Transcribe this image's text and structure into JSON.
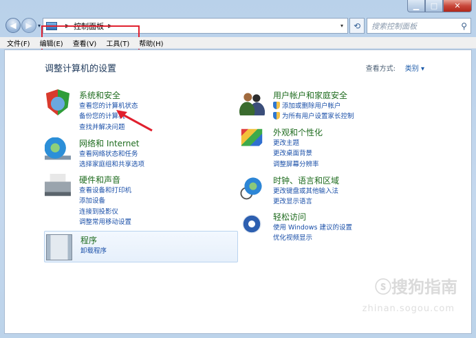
{
  "window": {
    "caption": {
      "minimize": "▁",
      "maximize": "□",
      "close": "✕"
    }
  },
  "nav": {
    "back": "◀",
    "forward": "▶",
    "dropdown": "▾",
    "breadcrumb": [
      "控制面板"
    ],
    "crumb_sep": "▶",
    "refresh": "⟲",
    "search_placeholder": "搜索控制面板",
    "search_icon": "⚲"
  },
  "menubar": [
    "文件(F)",
    "编辑(E)",
    "查看(V)",
    "工具(T)",
    "帮助(H)"
  ],
  "header": {
    "title": "调整计算机的设置",
    "view_by_label": "查看方式:",
    "view_by_value": "类别 ▾"
  },
  "categories_left": [
    {
      "title": "系统和安全",
      "icon": "shield-icon",
      "links": [
        "查看您的计算机状态",
        "备份您的计算机",
        "查找并解决问题"
      ]
    },
    {
      "title": "网络和 Internet",
      "icon": "network-globe-icon",
      "links": [
        "查看网络状态和任务",
        "选择家庭组和共享选项"
      ]
    },
    {
      "title": "硬件和声音",
      "icon": "printer-icon",
      "links": [
        "查看设备和打印机",
        "添加设备",
        "连接到投影仪",
        "调整常用移动设置"
      ]
    },
    {
      "title": "程序",
      "icon": "programs-icon",
      "links": [
        "卸载程序"
      ]
    }
  ],
  "categories_right": [
    {
      "title": "用户帐户和家庭安全",
      "icon": "users-icon",
      "links": [
        "添加或删除用户帐户",
        "为所有用户设置家长控制"
      ],
      "shield_links": [
        true,
        true
      ]
    },
    {
      "title": "外观和个性化",
      "icon": "display-icon",
      "links": [
        "更改主题",
        "更改桌面背景",
        "调整屏幕分辨率"
      ]
    },
    {
      "title": "时钟、语言和区域",
      "icon": "clock-globe-icon",
      "links": [
        "更改键盘或其他输入法",
        "更改显示语言"
      ]
    },
    {
      "title": "轻松访问",
      "icon": "ease-of-access-icon",
      "links": [
        "使用 Windows 建议的设置",
        "优化视频显示"
      ]
    }
  ],
  "watermark": {
    "brand": "ⓢ搜狗指南",
    "url": "zhinan.sogou.com"
  },
  "colors": {
    "highlight": "#e0202e",
    "link": "#1a4fa8",
    "heading": "#1e6b1e"
  }
}
